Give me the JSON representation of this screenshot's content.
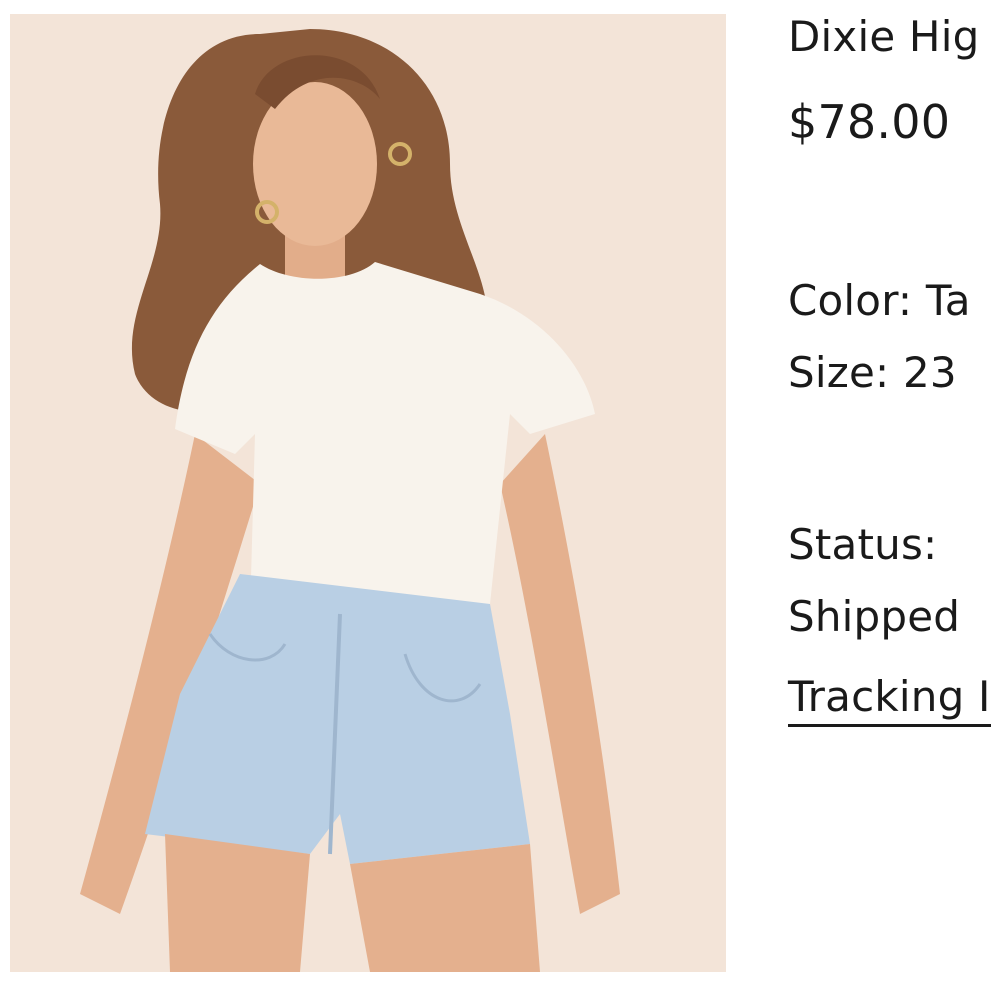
{
  "product": {
    "title": "Dixie Hig",
    "price": "$78.00",
    "color_label": "Color:",
    "color_value": "Ta",
    "size_label": "Size:",
    "size_value": "23",
    "status_label": "Status:",
    "status_value": "Shipped",
    "tracking_link_text": "Tracking I"
  },
  "colors": {
    "text": "#1a1a1a",
    "photo_background": "#f3e4d8",
    "shirt": "#f8f3ec",
    "denim": "#b9cfe4",
    "hair": "#8a5a3a",
    "skin": "#e9b997"
  }
}
